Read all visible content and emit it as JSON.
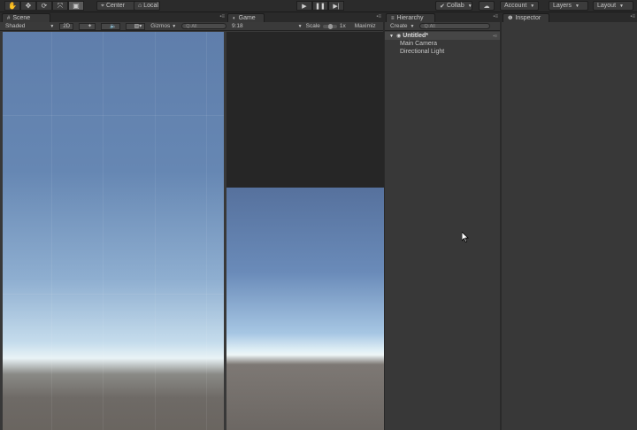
{
  "toolbar": {
    "tools": [
      "hand-tool",
      "move-tool",
      "rotate-tool",
      "scale-tool",
      "rect-tool"
    ],
    "pivot_label": "Center",
    "space_label": "Local",
    "collab_label": "Collab",
    "account_label": "Account",
    "layers_label": "Layers",
    "layout_label": "Layout"
  },
  "scene_panel": {
    "tab_label": "Scene",
    "shading_mode": "Shaded",
    "mode_2d": "2D",
    "gizmos_label": "Gizmos",
    "search_placeholder": "Q·All"
  },
  "game_panel": {
    "tab_label": "Game",
    "aspect": "9:18",
    "scale_label": "Scale",
    "scale_value": "1x",
    "maximize_label": "Maximiz"
  },
  "hierarchy_panel": {
    "tab_label": "Hierarchy",
    "create_label": "Create",
    "search_placeholder": "Q·All",
    "scene_name": "Untitled*",
    "items": [
      {
        "label": "Main Camera"
      },
      {
        "label": "Directional Light"
      }
    ]
  },
  "inspector_panel": {
    "tab_label": "Inspector"
  },
  "colors": {
    "editor_bg": "#383838",
    "toolbar_bg": "#2b2b2b",
    "sky_top": "#5f7eab",
    "horizon": "#e9f3f6",
    "ground": "#6a6560"
  }
}
